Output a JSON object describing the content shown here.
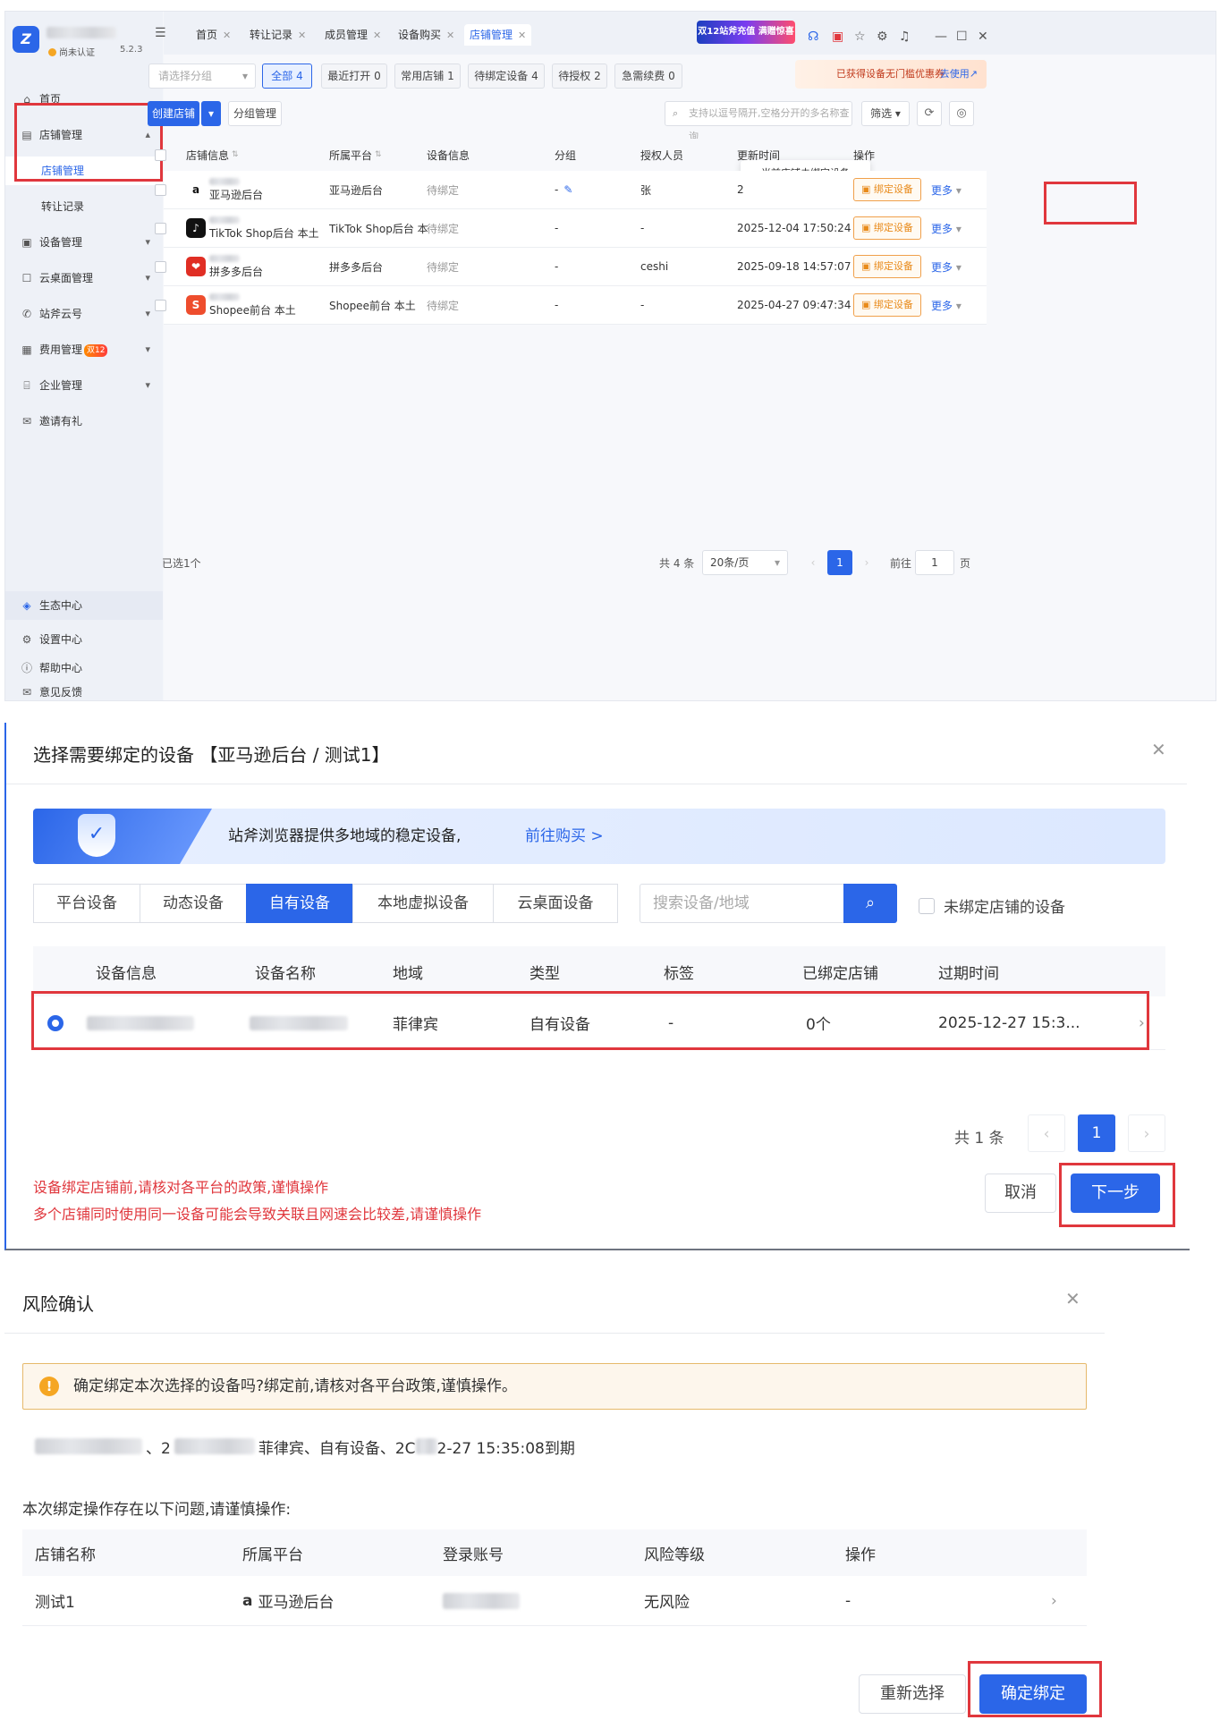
{
  "app": {
    "version": "5.2.3",
    "cert_status": "尚未认证",
    "sidebar": {
      "items": [
        {
          "label": "首页",
          "icon": "home-icon"
        },
        {
          "label": "店铺管理",
          "icon": "store-icon",
          "expanded": true
        },
        {
          "label": "店铺管理",
          "sub": true,
          "active": true
        },
        {
          "label": "转让记录",
          "sub": true
        },
        {
          "label": "设备管理",
          "icon": "device-icon"
        },
        {
          "label": "云桌面管理",
          "icon": "cloud-desktop-icon"
        },
        {
          "label": "站斧云号",
          "icon": "phone-icon"
        },
        {
          "label": "费用管理",
          "icon": "billing-icon",
          "badge": "双12"
        },
        {
          "label": "企业管理",
          "icon": "enterprise-icon"
        },
        {
          "label": "邀请有礼",
          "icon": "gift-icon"
        }
      ],
      "bottom": [
        {
          "label": "生态中心",
          "icon": "ecosystem-icon"
        },
        {
          "label": "设置中心",
          "icon": "settings-icon"
        },
        {
          "label": "帮助中心",
          "icon": "help-icon"
        },
        {
          "label": "意见反馈",
          "icon": "feedback-icon"
        }
      ]
    },
    "tabs": [
      {
        "label": "首页"
      },
      {
        "label": "转让记录"
      },
      {
        "label": "成员管理"
      },
      {
        "label": "设备购买"
      },
      {
        "label": "店铺管理",
        "active": true
      }
    ],
    "promo_banner": "双12站斧充值 满赠惊喜",
    "filter": {
      "group_placeholder": "请选择分组",
      "pills": [
        {
          "label": "全部 4",
          "active": true
        },
        {
          "label": "最近打开 0"
        },
        {
          "label": "常用店铺 1"
        },
        {
          "label": "待绑定设备 4"
        },
        {
          "label": "待授权 2"
        },
        {
          "label": "急需续费 0"
        }
      ],
      "coupon_text": "已获得设备无门槛优惠券",
      "coupon_link": "去使用↗"
    },
    "toolbar": {
      "create_label": "创建店铺",
      "group_manage_label": "分组管理",
      "search_placeholder": "支持以逗号隔开,空格分开的多名称查询",
      "filter_label": "筛选"
    },
    "table": {
      "headers": [
        "店铺信息",
        "所属平台",
        "设备信息",
        "分组",
        "授权人员",
        "更新时间",
        "操作"
      ],
      "rows": [
        {
          "name": "亚马逊后台",
          "platform": "亚马逊后台",
          "device": "待绑定",
          "group": "-",
          "auth": "张",
          "updated": "2",
          "bind": "绑定设备",
          "more": "更多",
          "logo": "a",
          "logo_bg": "#ffffff",
          "logo_fg": "#111111"
        },
        {
          "name": "TikTok Shop后台 本土",
          "platform": "TikTok Shop后台 本",
          "device": "待绑定",
          "group": "-",
          "auth": "-",
          "updated": "2025-12-04 17:50:24",
          "bind": "绑定设备",
          "more": "更多",
          "logo": "♪",
          "logo_bg": "#111111",
          "logo_fg": "#ffffff"
        },
        {
          "name": "拼多多后台",
          "platform": "拼多多后台",
          "device": "待绑定",
          "group": "-",
          "auth": "ceshi",
          "updated": "2025-09-18 14:57:07",
          "bind": "绑定设备",
          "more": "更多",
          "logo": "❤",
          "logo_bg": "#e02e24",
          "logo_fg": "#ffffff"
        },
        {
          "name": "Shopee前台 本土",
          "platform": "Shopee前台 本土",
          "device": "待绑定",
          "group": "-",
          "auth": "-",
          "updated": "2025-04-27 09:47:34",
          "bind": "绑定设备",
          "more": "更多",
          "logo": "S",
          "logo_bg": "#ee4d2d",
          "logo_fg": "#ffffff"
        }
      ],
      "tooltip": "当前店铺未绑定设备"
    },
    "footer": {
      "selected": "已选1个",
      "total": "共 4 条",
      "page_size": "20条/页",
      "current_page": "1",
      "goto_label": "前往",
      "goto_value": "1",
      "page_unit": "页"
    }
  },
  "device_dialog": {
    "title": "选择需要绑定的设备 【亚马逊后台 / 测试1】",
    "banner_text": "站斧浏览器提供多地域的稳定设备,",
    "banner_link": "前往购买 >",
    "tabs": [
      {
        "label": "平台设备"
      },
      {
        "label": "动态设备"
      },
      {
        "label": "自有设备",
        "active": true
      },
      {
        "label": "本地虚拟设备"
      },
      {
        "label": "云桌面设备"
      }
    ],
    "search_placeholder": "搜索设备/地域",
    "unbound_only_label": "未绑定店铺的设备",
    "headers": [
      "设备信息",
      "设备名称",
      "地域",
      "类型",
      "标签",
      "已绑定店铺",
      "过期时间"
    ],
    "row": {
      "region": "菲律宾",
      "type": "自有设备",
      "tag": "-",
      "bound": "0个",
      "expire": "2025-12-27 15:3..."
    },
    "total": "共 1 条",
    "current_page": "1",
    "warning_1": "设备绑定店铺前,请核对各平台的政策,谨慎操作",
    "warning_2": "多个店铺同时使用同一设备可能会导致关联且网速会比较差,请谨慎操作",
    "cancel_label": "取消",
    "next_label": "下一步"
  },
  "risk_dialog": {
    "title": "风险确认",
    "alert": "确定绑定本次选择的设备吗?绑定前,请核对各平台政策,谨慎操作。",
    "info_mid": "菲律宾、自有设备、2C",
    "info_tail": "2-27 15:35:08到期",
    "note": "本次绑定操作存在以下问题,请谨慎操作:",
    "headers": [
      "店铺名称",
      "所属平台",
      "登录账号",
      "风险等级",
      "操作"
    ],
    "row": {
      "store": "测试1",
      "platform": "亚马逊后台",
      "risk": "无风险",
      "op": "-"
    },
    "reselect_label": "重新选择",
    "confirm_label": "确定绑定"
  }
}
